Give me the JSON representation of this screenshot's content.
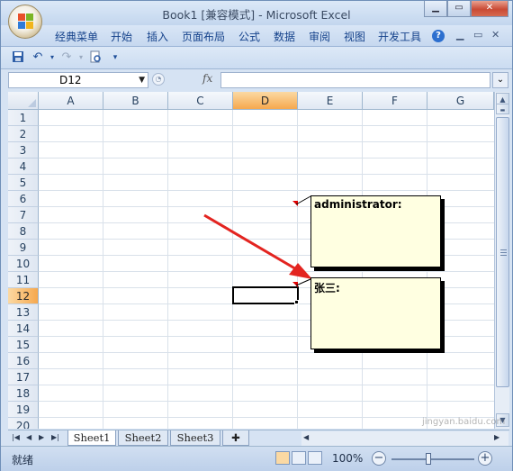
{
  "window": {
    "title": "Book1  [兼容模式] - Microsoft Excel",
    "minimize": "▁",
    "maximize": "▭",
    "close": "✕"
  },
  "ribbon": {
    "tabs": [
      "经典菜单",
      "开始",
      "插入",
      "页面布局",
      "公式",
      "数据",
      "审阅",
      "视图",
      "开发工具"
    ],
    "help": "?",
    "ribbon_minimize": "▁",
    "ribbon_restore": "▭",
    "ribbon_close": "✕"
  },
  "quick_access": {
    "save_icon": "save-icon",
    "undo_icon": "undo-icon",
    "redo_icon": "redo-icon",
    "print_preview_icon": "print-preview-icon",
    "customize_icon": "customize-icon"
  },
  "formula_bar": {
    "name_box": "D12",
    "fx": "fx",
    "formula": ""
  },
  "grid": {
    "columns": [
      "A",
      "B",
      "C",
      "D",
      "E",
      "F",
      "G"
    ],
    "rows": [
      "1",
      "2",
      "3",
      "4",
      "5",
      "6",
      "7",
      "8",
      "9",
      "10",
      "11",
      "12",
      "13",
      "14",
      "15",
      "16",
      "17",
      "18",
      "19",
      "20"
    ],
    "selected_column": "D",
    "selected_row": "12"
  },
  "comments": [
    {
      "author": "administrator:",
      "text": ""
    },
    {
      "author": "张三:",
      "text": ""
    }
  ],
  "sheets": {
    "tabs": [
      "Sheet1",
      "Sheet2",
      "Sheet3"
    ],
    "active": "Sheet1"
  },
  "status_bar": {
    "status": "就绪",
    "zoom": "100%"
  },
  "colors": {
    "accent": "#15428b",
    "arrow": "#e32420",
    "comment_bg": "#ffffe1",
    "selected_header": "#f6a84e"
  },
  "watermark": "jingyan.baidu.com"
}
